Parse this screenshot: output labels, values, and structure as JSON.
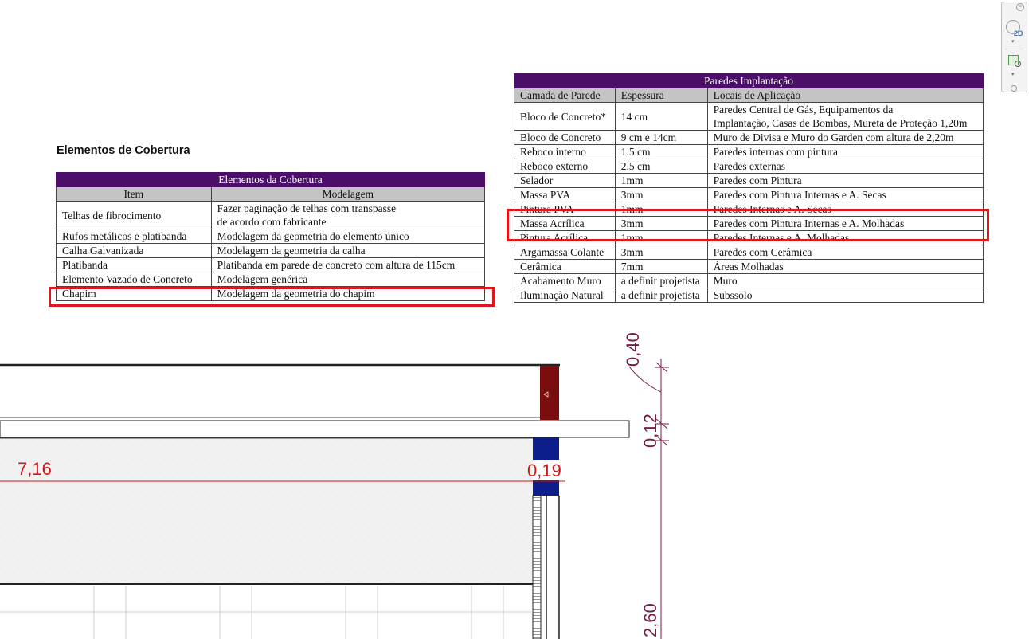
{
  "section_title": "Elementos de Cobertura",
  "cobertura_table": {
    "title": "Elementos da Cobertura",
    "headers": [
      "Item",
      "Modelagem"
    ],
    "rows": [
      [
        "Telhas de fibrocimento",
        "Fazer paginação de telhas com transpasse",
        "de acordo com fabricante"
      ],
      [
        "Rufos metálicos e platibanda",
        "Modelagem da geometria do elemento único"
      ],
      [
        "Calha Galvanizada",
        "Modelagem da geometria da calha"
      ],
      [
        "Platibanda",
        "Platibanda em parede de concreto com altura de 115cm"
      ],
      [
        "Elemento Vazado de Concreto",
        "Modelagem genérica"
      ],
      [
        "Chapim",
        "Modelagem da geometria do chapim"
      ]
    ]
  },
  "paredes_table": {
    "title": "Paredes Implantação",
    "headers": [
      "Camada de Parede",
      "Espessura",
      "Locais de Aplicação"
    ],
    "rows": [
      [
        "Bloco de Concreto*",
        "14 cm",
        "Paredes Central de Gás, Equipamentos da",
        "Implantação, Casas de Bombas, Mureta de Proteção 1,20m"
      ],
      [
        "Bloco de Concreto",
        "9 cm e 14cm",
        "Muro de Divisa e Muro do Garden com altura de 2,20m"
      ],
      [
        "Reboco interno",
        "1.5 cm",
        "Paredes internas com pintura"
      ],
      [
        "Reboco externo",
        "2.5 cm",
        "Paredes externas"
      ],
      [
        "Selador",
        "1mm",
        "Paredes com Pintura"
      ],
      [
        "Massa PVA",
        "3mm",
        "Paredes com Pintura Internas e A. Secas"
      ],
      [
        "Pintura PVA",
        "1mm",
        "Paredes Internas e A. Secas"
      ],
      [
        "Massa Acrílica",
        "3mm",
        "Paredes com Pintura Internas e A. Molhadas"
      ],
      [
        "Pintura Acrílica",
        "1mm",
        "Paredes Internas e A. Molhadas"
      ],
      [
        "Argamassa Colante",
        "3mm",
        "Paredes com Cerâmica"
      ],
      [
        "Cerâmica",
        "7mm",
        "Áreas Molhadas"
      ],
      [
        "Acabamento Muro",
        "a definir projetista",
        "Muro"
      ],
      [
        "Iluminação Natural",
        "a definir projetista",
        "Subssolo"
      ]
    ]
  },
  "drawing": {
    "dim_716": "7,16",
    "dim_019": "0,19",
    "dim_040": "0,40",
    "dim_012": "0,12",
    "dim_260": "2,60"
  },
  "nav_widget": {
    "view_mode": "2D"
  }
}
